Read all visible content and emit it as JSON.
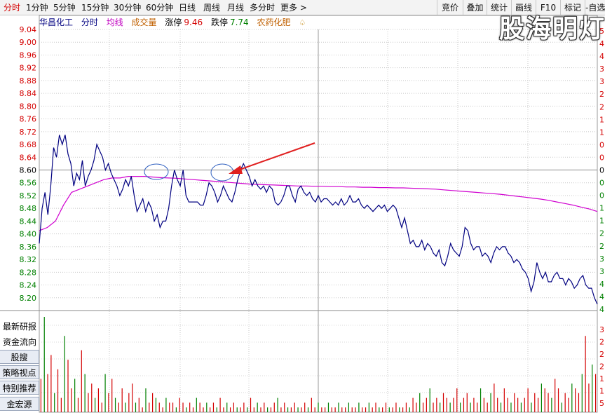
{
  "toolbar": {
    "tabs": [
      {
        "label": "分时",
        "active": true
      },
      {
        "label": "1分钟"
      },
      {
        "label": "5分钟"
      },
      {
        "label": "15分钟"
      },
      {
        "label": "30分钟"
      },
      {
        "label": "60分钟"
      },
      {
        "label": "日线"
      },
      {
        "label": "周线"
      },
      {
        "label": "月线"
      },
      {
        "label": "多分时"
      },
      {
        "label": "更多 >"
      }
    ],
    "right_buttons": [
      "竞价",
      "叠加",
      "统计",
      "画线",
      "F10",
      "标记",
      "-自选"
    ]
  },
  "legend": {
    "stock_name": "华昌化工",
    "timeshare": "分时",
    "avg_line": "均线",
    "volume": "成交量",
    "limit_up_label": "涨停",
    "limit_up_value": "9.46",
    "limit_down_label": "跌停",
    "limit_down_value": "7.74",
    "concept": "农药化肥",
    "bell_icon": "bell-icon"
  },
  "watermark": "股海明灯",
  "side_panel": [
    "最新研报",
    "资金流向",
    "股搜",
    "策略视点",
    "特别推荐",
    "金宏源"
  ],
  "colors": {
    "price_line": "#000080",
    "avg_line": "#d000d0",
    "axis_red": "#d40000",
    "axis_green": "#008000",
    "volume_bar": "#d40000"
  },
  "chart_data": {
    "type": "line",
    "y_ticks": [
      "9.04",
      "9.00",
      "8.96",
      "8.92",
      "8.88",
      "8.84",
      "8.80",
      "8.76",
      "8.72",
      "8.68",
      "8.64",
      "8.60",
      "8.56",
      "8.52",
      "8.48",
      "8.44",
      "8.40",
      "8.36",
      "8.32",
      "8.28",
      "8.24",
      "8.20"
    ],
    "y_range": [
      8.16,
      9.04
    ],
    "prev_close": 8.6,
    "right_axis_digits": [
      "5",
      "4",
      "4",
      "3",
      "3",
      "2",
      "2",
      "1",
      "1",
      "0",
      "0",
      "0",
      "0",
      "0",
      "1",
      "1",
      "2",
      "2",
      "3",
      "3",
      "4",
      "4",
      "4"
    ],
    "volume_axis_digits": [
      "3",
      "2",
      "2",
      "2",
      "1",
      "1",
      "5"
    ],
    "series": [
      {
        "values": [
          8.37,
          8.48,
          8.53,
          8.46,
          8.55,
          8.67,
          8.64,
          8.71,
          8.68,
          8.71,
          8.65,
          8.62,
          8.55,
          8.59,
          8.57,
          8.63,
          8.55,
          8.58,
          8.6,
          8.63,
          8.68,
          8.66,
          8.64,
          8.6,
          8.62,
          8.59,
          8.57,
          8.55,
          8.52,
          8.54,
          8.57,
          8.55,
          8.58,
          8.52,
          8.47,
          8.49,
          8.51,
          8.47,
          8.5,
          8.48,
          8.44,
          8.46,
          8.42,
          8.44,
          8.44,
          8.48,
          8.55,
          8.6,
          8.57,
          8.55,
          8.6,
          8.52,
          8.5,
          8.5,
          8.5,
          8.5,
          8.49,
          8.49,
          8.52,
          8.56,
          8.55,
          8.53,
          8.5,
          8.52,
          8.55,
          8.53,
          8.51,
          8.5,
          8.53,
          8.57,
          8.6,
          8.62,
          8.6,
          8.58,
          8.55,
          8.57,
          8.55,
          8.54,
          8.55,
          8.53,
          8.55,
          8.54,
          8.5,
          8.49,
          8.5,
          8.52,
          8.55,
          8.55,
          8.52,
          8.5,
          8.54,
          8.55,
          8.53,
          8.52,
          8.53,
          8.51,
          8.5,
          8.52,
          8.5,
          8.51,
          8.51,
          8.5,
          8.49,
          8.5,
          8.49,
          8.51,
          8.49,
          8.5,
          8.52,
          8.5,
          8.5,
          8.51,
          8.49,
          8.48,
          8.49,
          8.48,
          8.47,
          8.48,
          8.49,
          8.48,
          8.49,
          8.47,
          8.48,
          8.49,
          8.48,
          8.45,
          8.42,
          8.45,
          8.41,
          8.37,
          8.38,
          8.36,
          8.36,
          8.38,
          8.35,
          8.37,
          8.36,
          8.34,
          8.33,
          8.35,
          8.31,
          8.3,
          8.33,
          8.37,
          8.35,
          8.34,
          8.33,
          8.36,
          8.42,
          8.41,
          8.37,
          8.35,
          8.36,
          8.36,
          8.33,
          8.34,
          8.33,
          8.31,
          8.34,
          8.36,
          8.35,
          8.36,
          8.36,
          8.34,
          8.33,
          8.31,
          8.32,
          8.31,
          8.29,
          8.28,
          8.26,
          8.22,
          8.25,
          8.31,
          8.28,
          8.26,
          8.28,
          8.25,
          8.25,
          8.27,
          8.28,
          8.26,
          8.26,
          8.24,
          8.26,
          8.25,
          8.23,
          8.24,
          8.26,
          8.27,
          8.24,
          8.23,
          8.23,
          8.2,
          8.18
        ]
      },
      {
        "values": [
          8.41,
          8.42,
          8.44,
          8.49,
          8.53,
          8.54,
          8.55,
          8.56,
          8.57,
          8.575,
          8.575,
          8.58,
          8.58,
          8.58,
          8.578,
          8.576,
          8.575,
          8.574,
          8.572,
          8.57,
          8.568,
          8.566,
          8.564,
          8.562,
          8.56,
          8.558,
          8.556,
          8.555,
          8.554,
          8.553,
          8.552,
          8.551,
          8.55,
          8.55,
          8.549,
          8.549,
          8.548,
          8.548,
          8.547,
          8.547,
          8.546,
          8.546,
          8.545,
          8.545,
          8.544,
          8.544,
          8.543,
          8.542,
          8.541,
          8.54,
          8.538,
          8.536,
          8.534,
          8.532,
          8.53,
          8.528,
          8.526,
          8.524,
          8.521,
          8.518,
          8.515,
          8.512,
          8.509,
          8.505,
          8.5,
          8.495,
          8.49,
          8.484,
          8.478,
          8.47
        ]
      }
    ],
    "volume": [
      7,
      20,
      8,
      12,
      4,
      9,
      3,
      16,
      11,
      5,
      7,
      3,
      13,
      8,
      4,
      6,
      3,
      5,
      2,
      8,
      4,
      7,
      3,
      2,
      5,
      2,
      4,
      6,
      2,
      3,
      1,
      5,
      2,
      4,
      3,
      2,
      1,
      3,
      2,
      2,
      1,
      3,
      2,
      1,
      2,
      1,
      3,
      2,
      1,
      2,
      1,
      2,
      1,
      3,
      1,
      2,
      1,
      2,
      1,
      1,
      2,
      1,
      3,
      1,
      2,
      1,
      2,
      1,
      1,
      2,
      3,
      1,
      2,
      1,
      1,
      2,
      1,
      1,
      2,
      1,
      3,
      1,
      2,
      1,
      1,
      2,
      1,
      1,
      2,
      1,
      1,
      2,
      1,
      1,
      2,
      1,
      1,
      2,
      1,
      2,
      1,
      1,
      2,
      1,
      1,
      2,
      1,
      1,
      2,
      1,
      3,
      2,
      4,
      2,
      3,
      5,
      2,
      3,
      2,
      4,
      3,
      2,
      3,
      5,
      2,
      3,
      4,
      2,
      3,
      2,
      5,
      3,
      2,
      4,
      6,
      3,
      2,
      5,
      3,
      2,
      4,
      3,
      2,
      3,
      5,
      2,
      4,
      3,
      6,
      5,
      4,
      3,
      7,
      5,
      2,
      4,
      3,
      6,
      5,
      4,
      8,
      16,
      6,
      10,
      8
    ]
  }
}
